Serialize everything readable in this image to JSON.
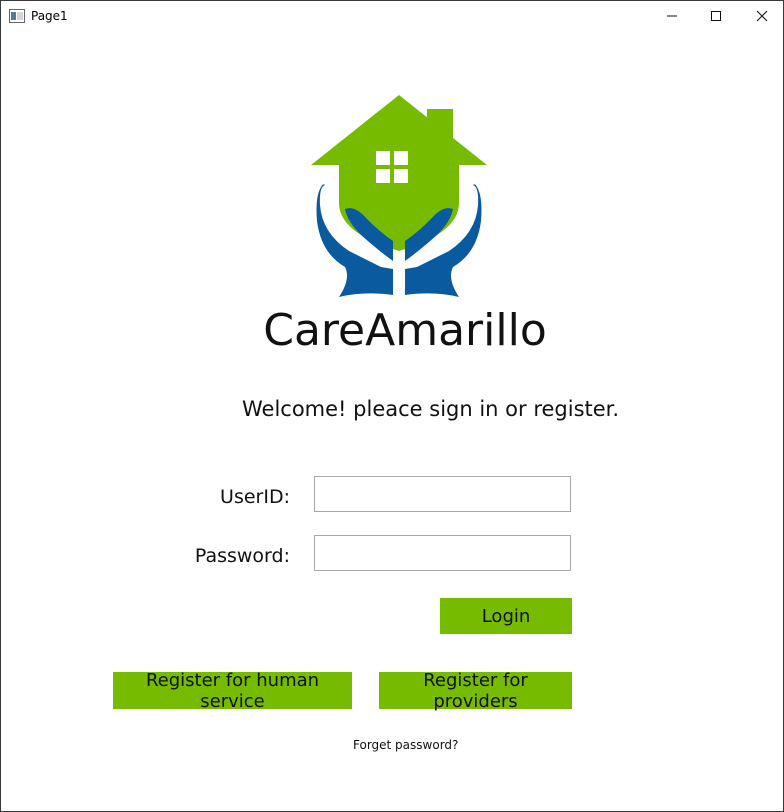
{
  "window": {
    "title": "Page1",
    "controls": [
      "minimize-icon",
      "maximize-icon",
      "close-icon"
    ]
  },
  "brand": {
    "name": "CareAmarillo",
    "logo": "house-in-hands-logo",
    "colors": {
      "green": "#76bb00",
      "blue": "#0a5aa0"
    }
  },
  "welcome_text": "Welcome! pleace sign in or register.",
  "form": {
    "userid_label": "UserID:",
    "userid_value": "",
    "password_label": "Password:",
    "password_value": ""
  },
  "buttons": {
    "login": "Login",
    "register_human": "Register for human service",
    "register_providers": "Register for providers"
  },
  "forget_password": "Forget password?",
  "accent_color": "#76bb00"
}
